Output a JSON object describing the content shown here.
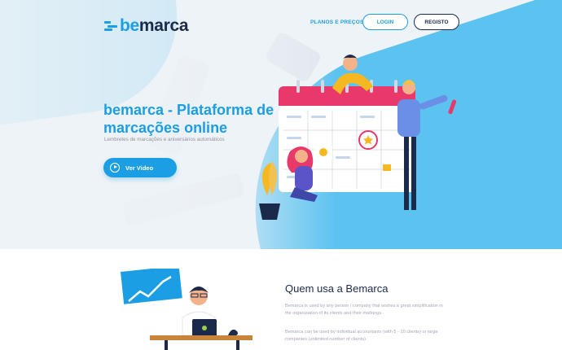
{
  "brand": {
    "logo_prefix": "be",
    "logo_suffix": "marca",
    "primary": "#1b9ee3",
    "dark": "#1b2a4a",
    "accent_blue": "#5cc2f0"
  },
  "nav": {
    "plans_label": "PLANOS E PREÇOS",
    "login_label": "LOGIN",
    "register_label": "REGISTO"
  },
  "hero": {
    "title": "bemarca - Plataforma de marcações online",
    "subtitle": "Lembretes de marcações e aniversários automáticos",
    "video_button": "Ver Video",
    "video_icon": "play-circle-icon"
  },
  "who": {
    "title": "Quem usa a Bemarca",
    "paragraph1": "Bemarca is used by any person / company that wishes a great simplification in the organization of its clients and their markings.",
    "paragraph2": "Bemarca can be used by individual accountants (with 5 - 10 clients) or large companies (unlimited number of clients)."
  }
}
